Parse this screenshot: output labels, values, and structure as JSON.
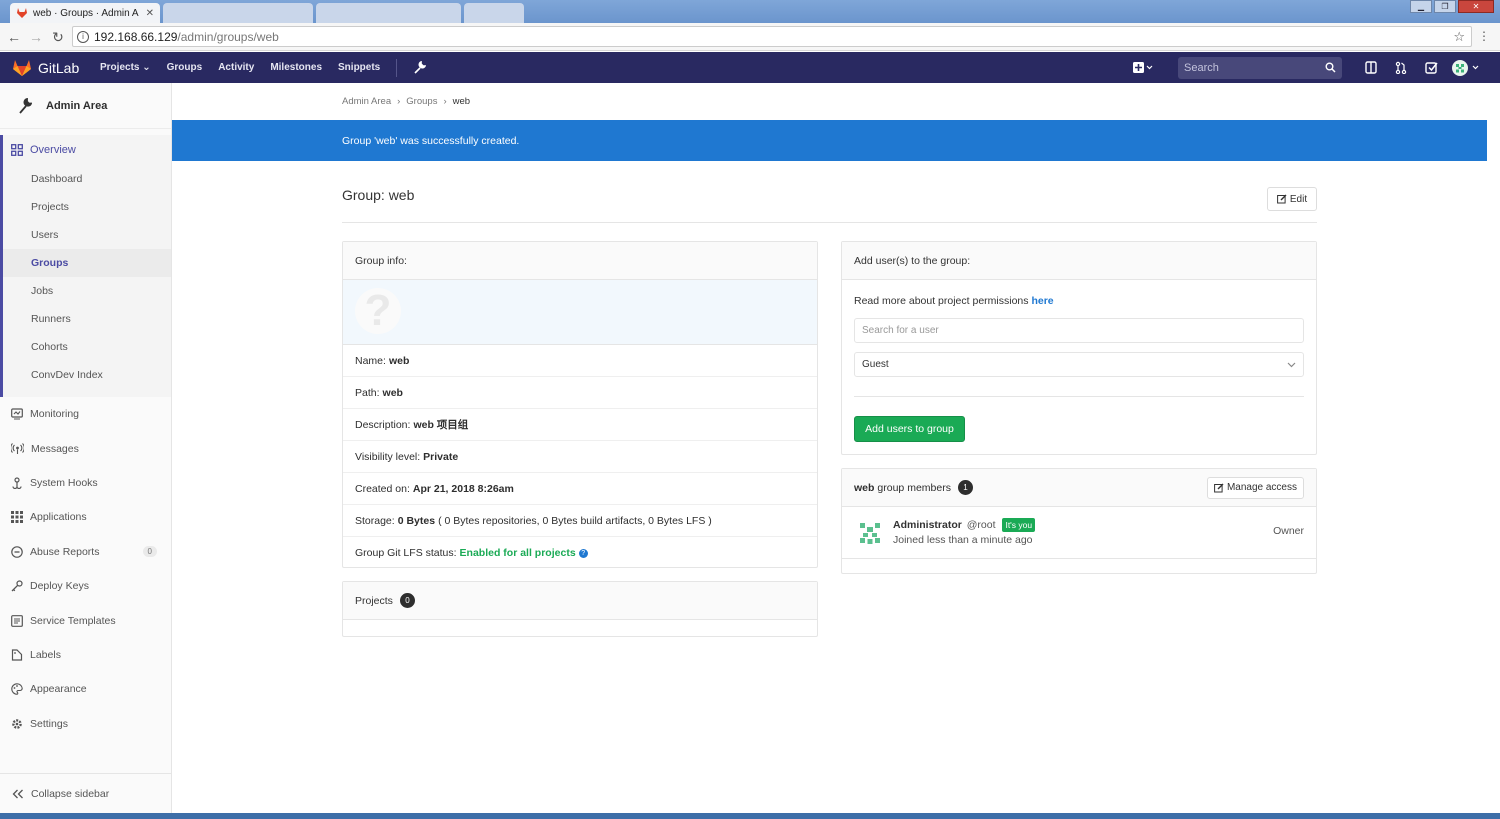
{
  "browser": {
    "tab_title": "web · Groups · Admin A",
    "url_host": "192.168.66.129",
    "url_path": "/admin/groups/web"
  },
  "header": {
    "brand": "GitLab",
    "nav": [
      "Projects",
      "Groups",
      "Activity",
      "Milestones",
      "Snippets"
    ],
    "search_placeholder": "Search"
  },
  "sidebar": {
    "title": "Admin Area",
    "overview_label": "Overview",
    "overview_items": [
      "Dashboard",
      "Projects",
      "Users",
      "Groups",
      "Jobs",
      "Runners",
      "Cohorts",
      "ConvDev Index"
    ],
    "active_item": "Groups",
    "items": [
      {
        "label": "Monitoring",
        "icon": "monitor-icon"
      },
      {
        "label": "Messages",
        "icon": "broadcast-icon"
      },
      {
        "label": "System Hooks",
        "icon": "hook-icon"
      },
      {
        "label": "Applications",
        "icon": "grid-icon"
      },
      {
        "label": "Abuse Reports",
        "icon": "abuse-icon",
        "count": "0"
      },
      {
        "label": "Deploy Keys",
        "icon": "key-icon"
      },
      {
        "label": "Service Templates",
        "icon": "template-icon"
      },
      {
        "label": "Labels",
        "icon": "label-icon"
      },
      {
        "label": "Appearance",
        "icon": "palette-icon"
      },
      {
        "label": "Settings",
        "icon": "gear-icon"
      }
    ],
    "collapse_label": "Collapse sidebar"
  },
  "breadcrumb": [
    "Admin Area",
    "Groups",
    "web"
  ],
  "flash": "Group 'web' was successfully created.",
  "page_title": "Group: web",
  "edit_label": "Edit",
  "group_info": {
    "heading": "Group info:",
    "name_label": "Name:",
    "name": "web",
    "path_label": "Path:",
    "path": "web",
    "description_label": "Description:",
    "description": "web 项目组",
    "visibility_label": "Visibility level:",
    "visibility": "Private",
    "created_label": "Created on:",
    "created": "Apr 21, 2018 8:26am",
    "storage_label": "Storage:",
    "storage": "0 Bytes",
    "storage_detail": "( 0 Bytes repositories, 0 Bytes build artifacts, 0 Bytes LFS )",
    "lfs_label": "Group Git LFS status:",
    "lfs": "Enabled for all projects"
  },
  "projects": {
    "heading": "Projects",
    "count": "0"
  },
  "add_users": {
    "heading": "Add user(s) to the group:",
    "perm_text": "Read more about project permissions",
    "perm_link": "here",
    "search_placeholder": "Search for a user",
    "role": "Guest",
    "button": "Add users to group"
  },
  "members": {
    "group_name": "web",
    "heading": "group members",
    "count": "1",
    "manage_label": "Manage access",
    "list": [
      {
        "name": "Administrator",
        "handle": "@root",
        "badge": "It's you",
        "joined": "Joined less than a minute ago",
        "role": "Owner"
      }
    ]
  },
  "colors": {
    "header": "#292961",
    "flash": "#1f78d1",
    "success": "#1aaa55",
    "accent": "#4b4ba3"
  }
}
